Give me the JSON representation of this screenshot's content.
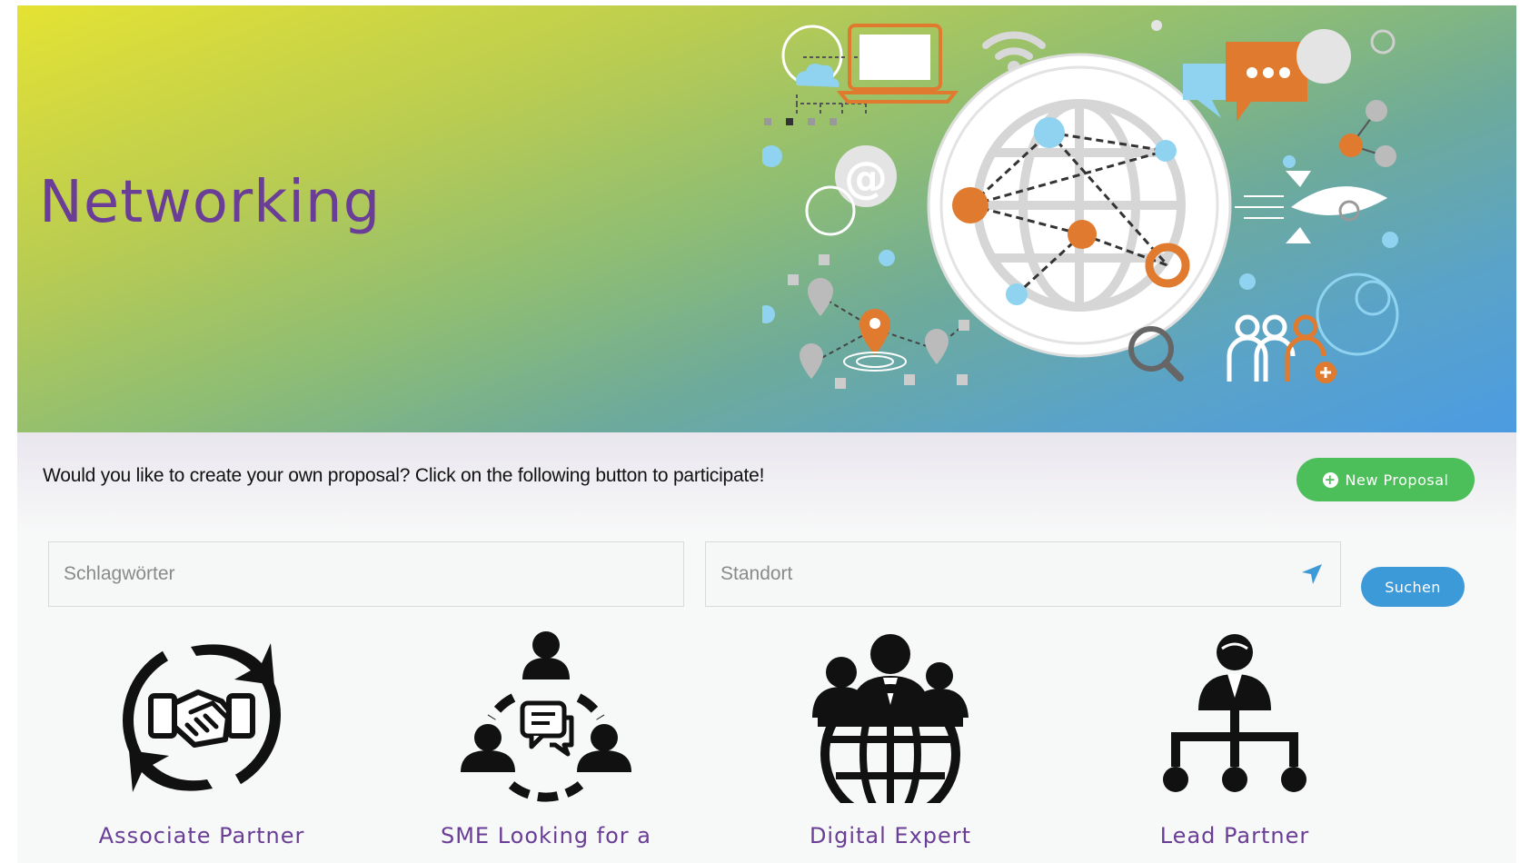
{
  "hero": {
    "title": "Networking",
    "accent_color": "#6a3d96"
  },
  "cta": {
    "text": "Would you like to create your own proposal? Click on the following button to participate!",
    "button_label": "New Proposal",
    "button_color": "#4cbf5a"
  },
  "search": {
    "keyword_placeholder": "Schlagwörter",
    "keyword_value": "",
    "location_placeholder": "Standort",
    "location_value": "",
    "button_label": "Suchen",
    "button_color": "#3d9ad9",
    "location_icon": "location-arrow-icon"
  },
  "categories": [
    {
      "label": "Associate Partner",
      "icon": "handshake-cycle-icon"
    },
    {
      "label": "SME Looking for a",
      "icon": "group-chat-icon"
    },
    {
      "label": "Digital Expert",
      "icon": "global-team-icon"
    },
    {
      "label": "Lead Partner",
      "icon": "hierarchy-icon"
    }
  ]
}
